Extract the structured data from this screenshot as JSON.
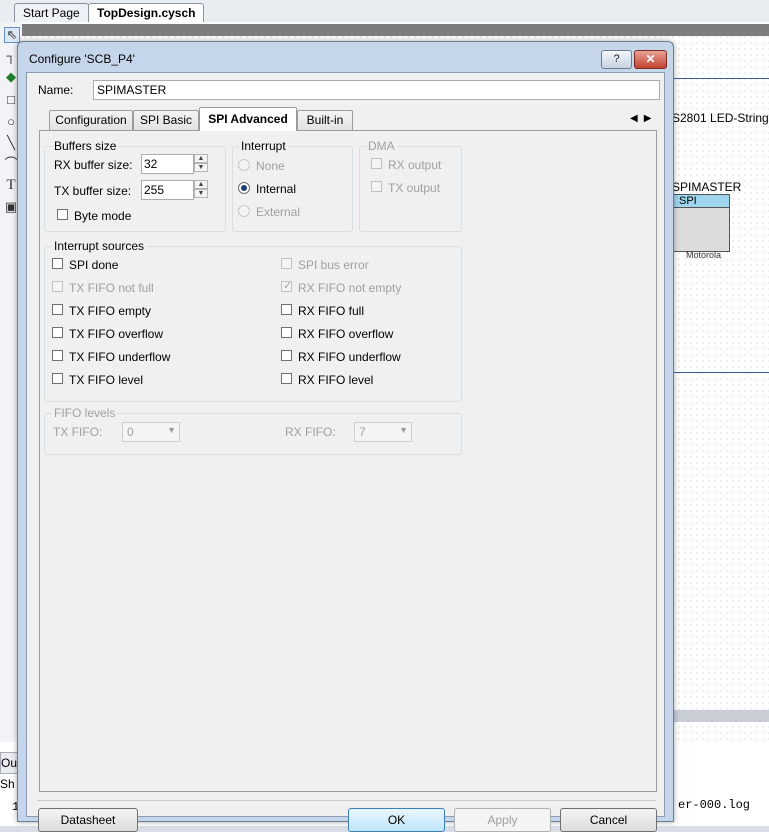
{
  "ide": {
    "tabs": [
      "Start Page",
      "TopDesign.cysch"
    ],
    "schematic_label": "S2801 LED-String",
    "component": {
      "name": "SPIMASTER",
      "header": "SPI",
      "footer": "Motorola"
    },
    "output_tab": "Ou",
    "show_text": "Sh",
    "log_text": "er-000.log",
    "line_text": "1"
  },
  "dialog": {
    "title": "Configure 'SCB_P4'",
    "help_label": "?",
    "close_label": "✕",
    "name_label": "Name:",
    "name_value": "SPIMASTER",
    "tabs": [
      "Configuration",
      "SPI Basic",
      "SPI Advanced",
      "Built-in"
    ],
    "active_tab": "SPI Advanced",
    "buffers": {
      "title": "Buffers size",
      "rx_label": "RX buffer size:",
      "rx_value": "32",
      "tx_label": "TX buffer size:",
      "tx_value": "255",
      "byte_mode_label": "Byte mode"
    },
    "interrupt": {
      "title": "Interrupt",
      "options": [
        "None",
        "Internal",
        "External"
      ],
      "selected": "Internal"
    },
    "dma": {
      "title": "DMA",
      "rx_label": "RX output",
      "tx_label": "TX output"
    },
    "sources": {
      "title": "Interrupt sources",
      "left": [
        "SPI done",
        "TX FIFO not full",
        "TX FIFO empty",
        "TX FIFO overflow",
        "TX FIFO underflow",
        "TX FIFO level"
      ],
      "right": [
        "SPI bus error",
        "RX FIFO not empty",
        "RX FIFO full",
        "RX FIFO overflow",
        "RX FIFO underflow",
        "RX FIFO level"
      ]
    },
    "fifo": {
      "title": "FIFO levels",
      "tx_label": "TX FIFO:",
      "tx_value": "0",
      "rx_label": "RX FIFO:",
      "rx_value": "7"
    },
    "buttons": {
      "datasheet": "Datasheet",
      "ok": "OK",
      "apply": "Apply",
      "cancel": "Cancel"
    }
  },
  "colors": {
    "dialog_frame": "#c6d6ea",
    "close_button": "#c1412f",
    "ok_button": "#bee6fd"
  }
}
